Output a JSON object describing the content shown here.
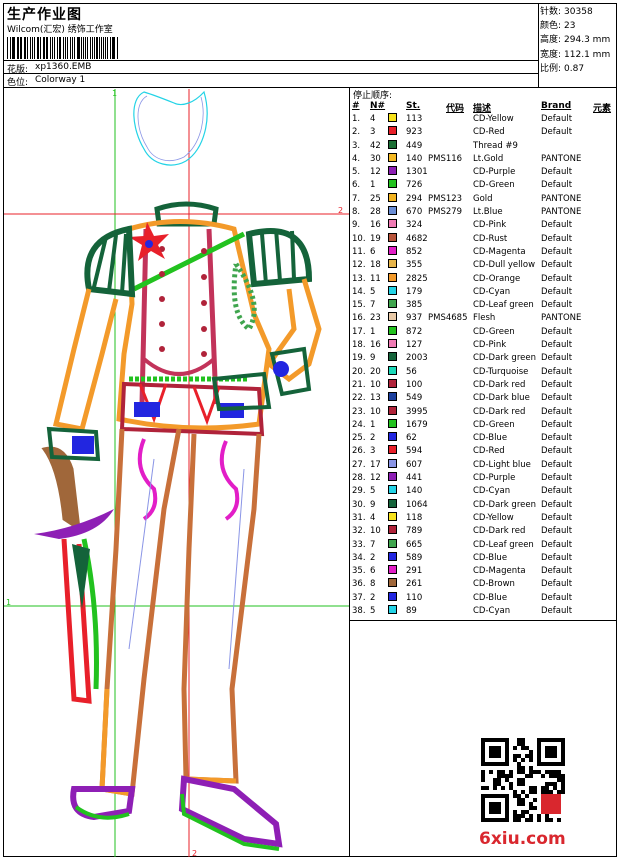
{
  "header": {
    "title": "生产作业图",
    "company": "Wilcom(汇宏)  绣饰工作室",
    "design_label": "花版:",
    "design_value": "xp1360.EMB",
    "colorway_label": "色位:",
    "colorway_value": "Colorway 1"
  },
  "stats": [
    {
      "label": "针数:",
      "value": "30358"
    },
    {
      "label": "颜色:",
      "value": "23"
    },
    {
      "label": "高度:",
      "value": "294.3 mm"
    },
    {
      "label": "宽度:",
      "value": "112.1 mm"
    },
    {
      "label": "比例:",
      "value": "0.87"
    }
  ],
  "stop_sequence_title": "停止顺序:",
  "table_headers": {
    "idx": "#",
    "n": "N#",
    "st": "St.",
    "code": "代码",
    "desc": "描述",
    "brand": "Brand",
    "element": "元素"
  },
  "rows": [
    {
      "idx": "1.",
      "n": "4",
      "st": "113",
      "code": "",
      "desc": "CD-Yellow",
      "brand": "Default",
      "color": "#f7e21b"
    },
    {
      "idx": "2.",
      "n": "3",
      "st": "923",
      "code": "",
      "desc": "CD-Red",
      "brand": "Default",
      "color": "#e8202a"
    },
    {
      "idx": "3.",
      "n": "42",
      "st": "449",
      "code": "",
      "desc": "Thread #9",
      "brand": "",
      "color": "#1a6e34"
    },
    {
      "idx": "4.",
      "n": "30",
      "st": "140",
      "code": "PMS116",
      "desc": "Lt.Gold",
      "brand": "PANTONE",
      "color": "#f4b923"
    },
    {
      "idx": "5.",
      "n": "12",
      "st": "1301",
      "code": "",
      "desc": "CD-Purple",
      "brand": "Default",
      "color": "#8e1fb5"
    },
    {
      "idx": "6.",
      "n": "1",
      "st": "726",
      "code": "",
      "desc": "CD-Green",
      "brand": "Default",
      "color": "#22c21f"
    },
    {
      "idx": "7.",
      "n": "25",
      "st": "294",
      "code": "PMS123",
      "desc": "Gold",
      "brand": "PANTONE",
      "color": "#f2b320"
    },
    {
      "idx": "8.",
      "n": "28",
      "st": "670",
      "code": "PMS279",
      "desc": "Lt.Blue",
      "brand": "PANTONE",
      "color": "#6b8ed6"
    },
    {
      "idx": "9.",
      "n": "16",
      "st": "324",
      "code": "",
      "desc": "CD-Pink",
      "brand": "Default",
      "color": "#f07bb4"
    },
    {
      "idx": "10.",
      "n": "19",
      "st": "4682",
      "code": "",
      "desc": "CD-Rust",
      "brand": "Default",
      "color": "#b8543a"
    },
    {
      "idx": "11.",
      "n": "6",
      "st": "852",
      "code": "",
      "desc": "CD-Magenta",
      "brand": "Default",
      "color": "#e21ec7"
    },
    {
      "idx": "12.",
      "n": "18",
      "st": "355",
      "code": "",
      "desc": "CD-Dull yellow",
      "brand": "Default",
      "color": "#e6b44a"
    },
    {
      "idx": "13.",
      "n": "11",
      "st": "2825",
      "code": "",
      "desc": "CD-Orange",
      "brand": "Default",
      "color": "#f39a2a"
    },
    {
      "idx": "14.",
      "n": "5",
      "st": "179",
      "code": "",
      "desc": "CD-Cyan",
      "brand": "Default",
      "color": "#23d3e6"
    },
    {
      "idx": "15.",
      "n": "7",
      "st": "385",
      "code": "",
      "desc": "CD-Leaf green",
      "brand": "Default",
      "color": "#3fa54e"
    },
    {
      "idx": "16.",
      "n": "23",
      "st": "937",
      "code": "PMS4685",
      "desc": "Flesh",
      "brand": "PANTONE",
      "color": "#e8c9a7"
    },
    {
      "idx": "17.",
      "n": "1",
      "st": "872",
      "code": "",
      "desc": "CD-Green",
      "brand": "Default",
      "color": "#22c21f"
    },
    {
      "idx": "18.",
      "n": "16",
      "st": "127",
      "code": "",
      "desc": "CD-Pink",
      "brand": "Default",
      "color": "#f07bb4"
    },
    {
      "idx": "19.",
      "n": "9",
      "st": "2003",
      "code": "",
      "desc": "CD-Dark green",
      "brand": "Default",
      "color": "#14633a"
    },
    {
      "idx": "20.",
      "n": "20",
      "st": "56",
      "code": "",
      "desc": "CD-Turquoise",
      "brand": "Default",
      "color": "#1ad9b9"
    },
    {
      "idx": "21.",
      "n": "10",
      "st": "100",
      "code": "",
      "desc": "CD-Dark red",
      "brand": "Default",
      "color": "#b0233a"
    },
    {
      "idx": "22.",
      "n": "13",
      "st": "549",
      "code": "",
      "desc": "CD-Dark blue",
      "brand": "Default",
      "color": "#1b3f9e"
    },
    {
      "idx": "23.",
      "n": "10",
      "st": "3995",
      "code": "",
      "desc": "CD-Dark red",
      "brand": "Default",
      "color": "#b0233a"
    },
    {
      "idx": "24.",
      "n": "1",
      "st": "1679",
      "code": "",
      "desc": "CD-Green",
      "brand": "Default",
      "color": "#22c21f"
    },
    {
      "idx": "25.",
      "n": "2",
      "st": "62",
      "code": "",
      "desc": "CD-Blue",
      "brand": "Default",
      "color": "#2226e0"
    },
    {
      "idx": "26.",
      "n": "3",
      "st": "594",
      "code": "",
      "desc": "CD-Red",
      "brand": "Default",
      "color": "#e8202a"
    },
    {
      "idx": "27.",
      "n": "17",
      "st": "607",
      "code": "",
      "desc": "CD-Light blue",
      "brand": "Default",
      "color": "#8a95e6"
    },
    {
      "idx": "28.",
      "n": "12",
      "st": "441",
      "code": "",
      "desc": "CD-Purple",
      "brand": "Default",
      "color": "#8e1fb5"
    },
    {
      "idx": "29.",
      "n": "5",
      "st": "140",
      "code": "",
      "desc": "CD-Cyan",
      "brand": "Default",
      "color": "#23d3e6"
    },
    {
      "idx": "30.",
      "n": "9",
      "st": "1064",
      "code": "",
      "desc": "CD-Dark green",
      "brand": "Default",
      "color": "#14633a"
    },
    {
      "idx": "31.",
      "n": "4",
      "st": "118",
      "code": "",
      "desc": "CD-Yellow",
      "brand": "Default",
      "color": "#f7e21b"
    },
    {
      "idx": "32.",
      "n": "10",
      "st": "789",
      "code": "",
      "desc": "CD-Dark red",
      "brand": "Default",
      "color": "#b0233a"
    },
    {
      "idx": "33.",
      "n": "7",
      "st": "665",
      "code": "",
      "desc": "CD-Leaf green",
      "brand": "Default",
      "color": "#3fa54e"
    },
    {
      "idx": "34.",
      "n": "2",
      "st": "589",
      "code": "",
      "desc": "CD-Blue",
      "brand": "Default",
      "color": "#2226e0"
    },
    {
      "idx": "35.",
      "n": "6",
      "st": "291",
      "code": "",
      "desc": "CD-Magenta",
      "brand": "Default",
      "color": "#e21ec7"
    },
    {
      "idx": "36.",
      "n": "8",
      "st": "261",
      "code": "",
      "desc": "CD-Brown",
      "brand": "Default",
      "color": "#a0673a"
    },
    {
      "idx": "37.",
      "n": "2",
      "st": "110",
      "code": "",
      "desc": "CD-Blue",
      "brand": "Default",
      "color": "#2226e0"
    },
    {
      "idx": "38.",
      "n": "5",
      "st": "89",
      "code": "",
      "desc": "CD-Cyan",
      "brand": "Default",
      "color": "#23d3e6"
    }
  ],
  "guides": {
    "top_marker": "1",
    "right_marker": "2",
    "left_marker": "1",
    "bottom_marker": "2"
  },
  "watermark": "6xiu.com",
  "colors": {
    "guide_green": "#22c21f",
    "guide_red": "#e8202a",
    "frame": "#000000"
  }
}
